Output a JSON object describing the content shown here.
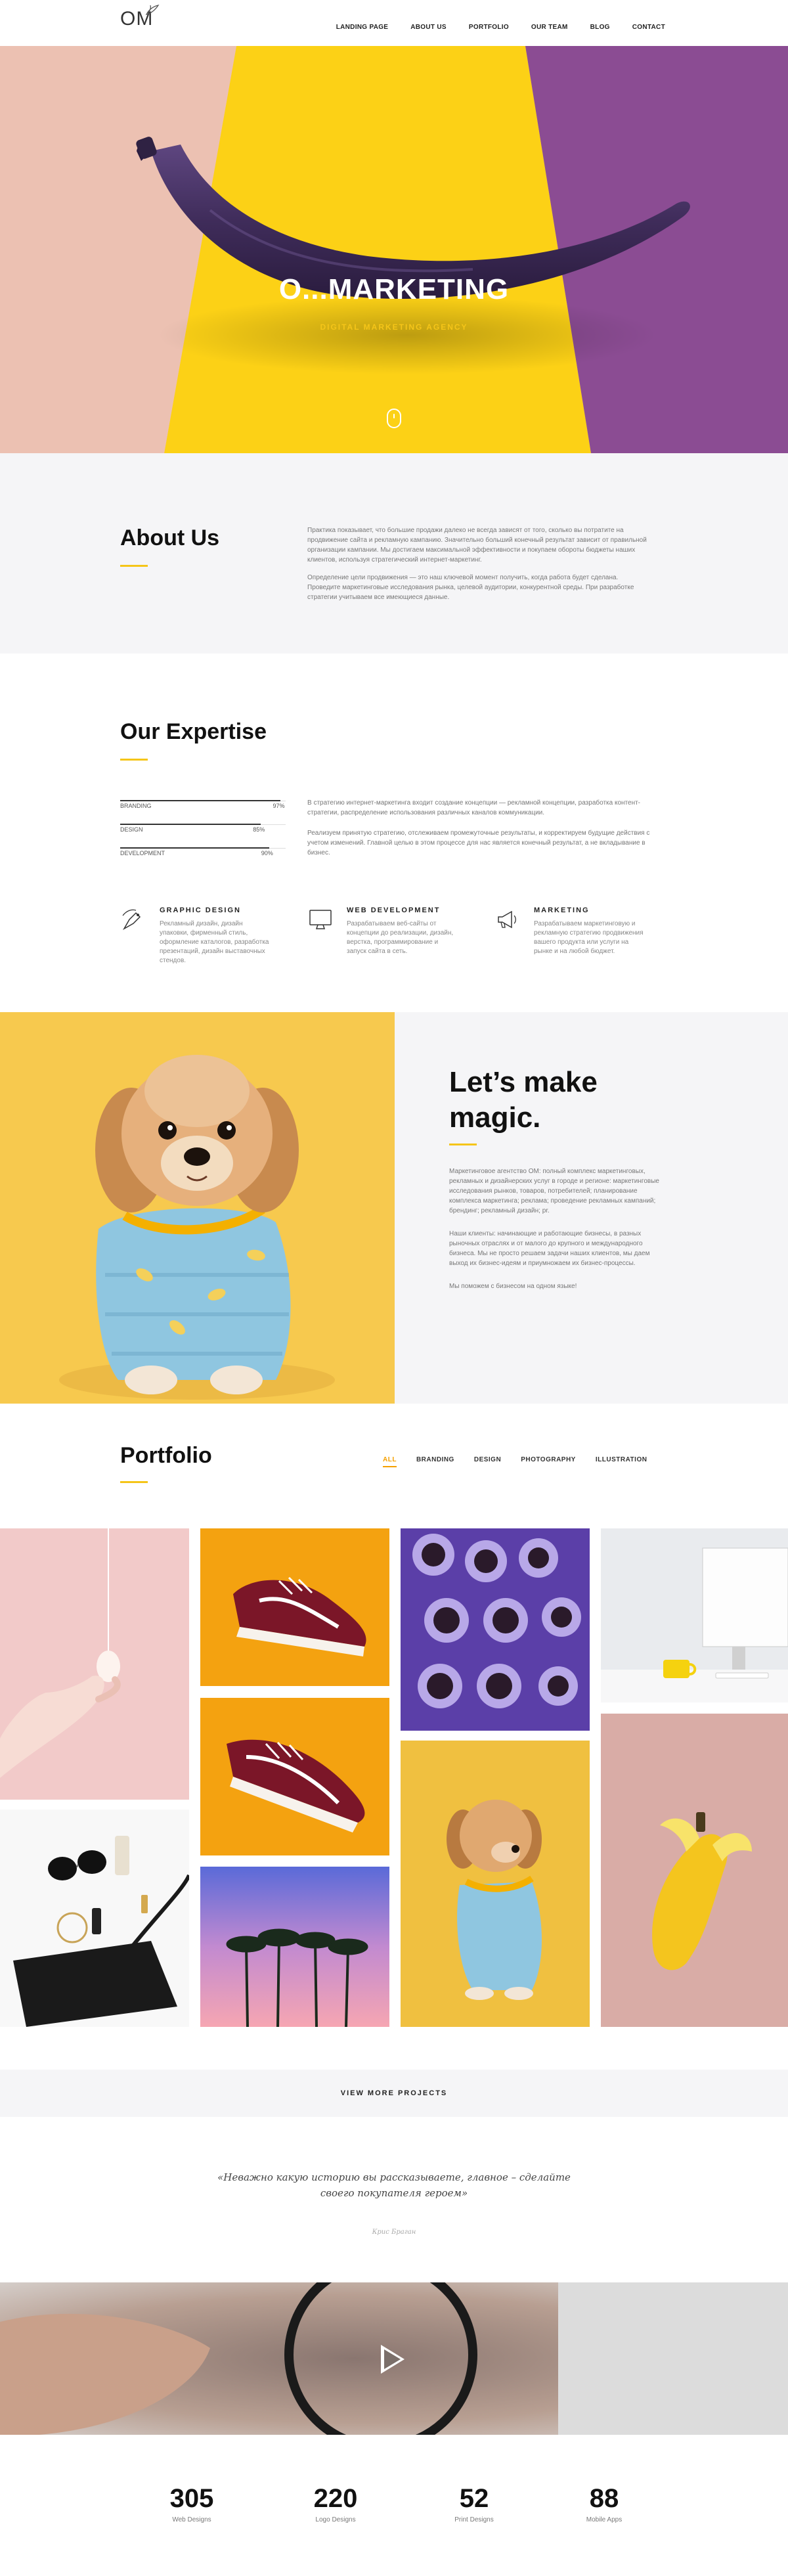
{
  "brand": {
    "logo_text": "OM"
  },
  "nav": [
    {
      "label": "LANDING PAGE"
    },
    {
      "label": "ABOUT US"
    },
    {
      "label": "PORTFOLIO"
    },
    {
      "label": "OUR TEAM"
    },
    {
      "label": "BLOG"
    },
    {
      "label": "CONTACT"
    }
  ],
  "hero": {
    "title": "O...MARKETING",
    "subtitle": "DIGITAL MARKETING AGENCY",
    "colors": {
      "left": "#edc7b8",
      "middle": "#fcd116",
      "right": "#8b4c93",
      "banana": "#4c3869"
    }
  },
  "about": {
    "title": "About Us",
    "paragraphs": [
      "Практика показывает, что большие продажи далеко не всегда зависят от того, сколько вы потратите на продвижение сайта и рекламную кампанию. Значительно больший конечный результат зависит от правильной организации кампании. Мы достигаем максимальной эффективности и покупаем обороты бюджеты наших клиентов, используя стратегический интернет-маркетинг.",
      "Определение цели продвижения — это наш ключевой момент получить, когда работа будет сделана. Проведите маркетинговые исследования рынка, целевой аудитории, конкурентной среды. При разработке стратегии учитываем все имеющиеся данные."
    ]
  },
  "expertise": {
    "title": "Our Expertise",
    "skills": [
      {
        "label": "BRANDING",
        "percent": 97,
        "percent_text": "97%"
      },
      {
        "label": "DESIGN",
        "percent": 85,
        "percent_text": "85%"
      },
      {
        "label": "DEVELOPMENT",
        "percent": 90,
        "percent_text": "90%"
      }
    ],
    "paragraphs": [
      "В стратегию интернет-маркетинга входит создание концепции — рекламной концепции, разработка контент-стратегии, распределение использования различных каналов коммуникации.",
      "Реализуем принятую стратегию, отслеживаем промежуточные результаты, и корректируем будущие действия с учетом изменений. Главной целью в этом процессе для нас является конечный результат, а не вкладывание в бизнес."
    ],
    "services": [
      {
        "title": "GRAPHIC DESIGN",
        "icon": "pen-tool-icon",
        "text": "Рекламный дизайн, дизайн упаковки, фирменный стиль, оформление каталогов, разработка презентаций, дизайн выставочных стендов."
      },
      {
        "title": "WEB DEVELOPMENT",
        "icon": "monitor-icon",
        "text": "Разрабатываем веб-сайты от концепции до реализации, дизайн, верстка, программирование и запуск сайта в сеть."
      },
      {
        "title": "MARKETING",
        "icon": "megaphone-icon",
        "text": "Разрабатываем маркетинговую и рекламную стратегию продвижения вашего продукта или услуги на рынке и на любой бюджет."
      }
    ]
  },
  "magic": {
    "title_line1": "Let’s make",
    "title_line2": "magic.",
    "paragraphs": [
      "Маркетинговое агентство ОМ: полный комплекс маркетинговых, рекламных и дизайнерских услуг в городе и регионе: маркетинговые исследования рынков, товаров, потребителей; планирование комплекса маркетинга; реклама; проведение рекламных кампаний; брендинг; рекламный дизайн; pr.",
      "Наши клиенты: начинающие и работающие бизнесы, в разных рыночных отраслях и от малого до крупного и международного бизнеса. Мы не просто решаем задачи наших клиентов, мы даем выход их бизнес-идеям и приумножаем их бизнес-процессы.",
      "Мы поможем с бизнесом на одном языке!"
    ]
  },
  "portfolio": {
    "title": "Portfolio",
    "filters": [
      {
        "label": "ALL",
        "active": true
      },
      {
        "label": "BRANDING",
        "active": false
      },
      {
        "label": "DESIGN",
        "active": false
      },
      {
        "label": "PHOTOGRAPHY",
        "active": false
      },
      {
        "label": "ILLUSTRATION",
        "active": false
      }
    ],
    "view_more": "VIEW MORE PROJECTS"
  },
  "quote": {
    "line1": "«Неважно какую историю вы рассказываете, главное – сделайте",
    "line2": "своего покупателя героем»",
    "author": "Крис Браган"
  },
  "stats": [
    {
      "number": "305",
      "label": "Web Designs"
    },
    {
      "number": "220",
      "label": "Logo Designs"
    },
    {
      "number": "52",
      "label": "Print Designs"
    },
    {
      "number": "88",
      "label": "Mobile Apps"
    }
  ]
}
